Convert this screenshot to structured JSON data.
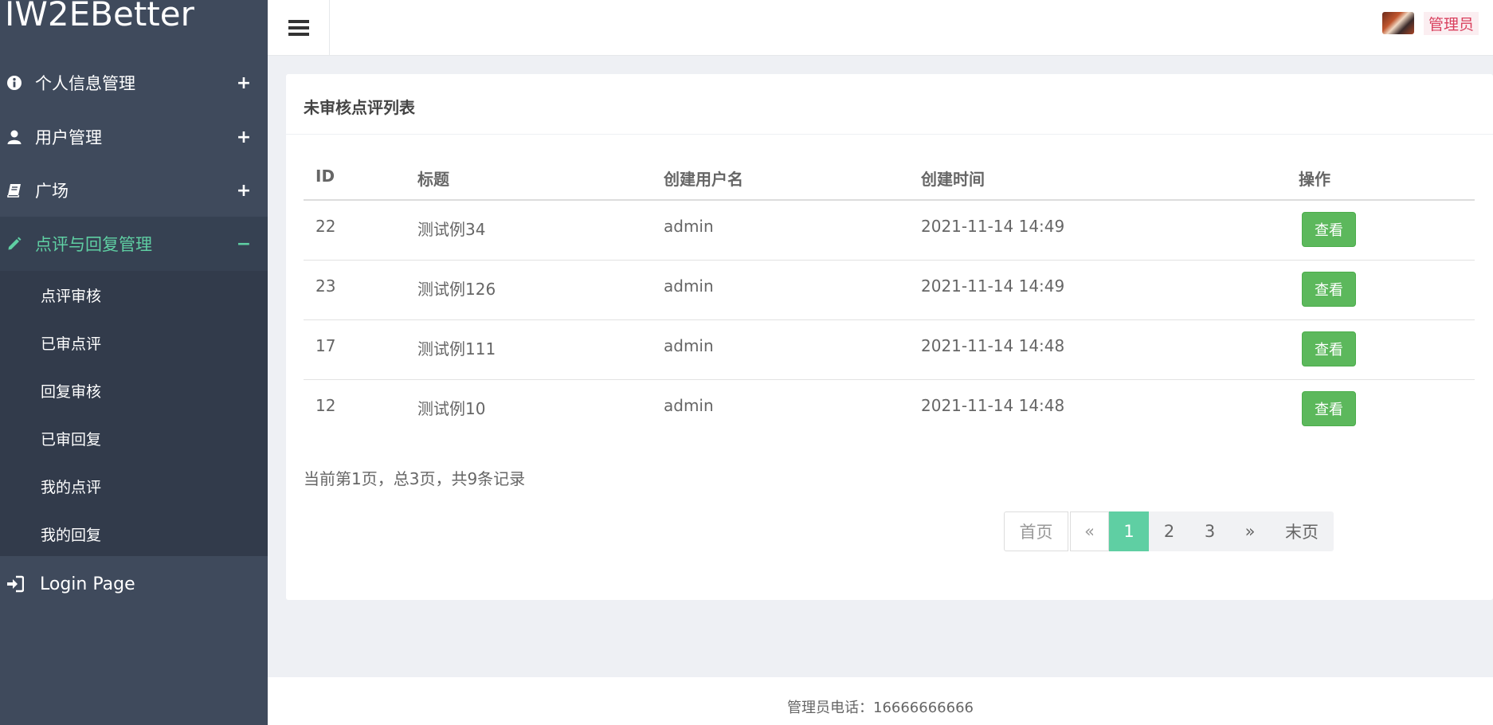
{
  "app": {
    "brand": "IW2EBetter"
  },
  "sidebar": {
    "items": [
      {
        "label": "个人信息管理",
        "toggle": "+"
      },
      {
        "label": "用户管理",
        "toggle": "+"
      },
      {
        "label": "广场",
        "toggle": "+"
      },
      {
        "label": "点评与回复管理",
        "toggle": "−"
      }
    ],
    "submenu": [
      "点评审核",
      "已审点评",
      "回复审核",
      "已审回复",
      "我的点评",
      "我的回复"
    ],
    "login": "Login Page",
    "active_color": "#5fcfa3"
  },
  "header": {
    "username": "管理员"
  },
  "main": {
    "title": "未审核点评列表",
    "columns": [
      "ID",
      "标题",
      "创建用户名",
      "创建时间",
      "操作"
    ],
    "rows": [
      {
        "id": "22",
        "title": "测试例34",
        "user": "admin",
        "time": "2021-11-14 14:49",
        "action": "查看"
      },
      {
        "id": "23",
        "title": "测试例126",
        "user": "admin",
        "time": "2021-11-14 14:49",
        "action": "查看"
      },
      {
        "id": "17",
        "title": "测试例111",
        "user": "admin",
        "time": "2021-11-14 14:48",
        "action": "查看"
      },
      {
        "id": "12",
        "title": "测试例10",
        "user": "admin",
        "time": "2021-11-14 14:48",
        "action": "查看"
      }
    ],
    "summary": "当前第1页，总3页，共9条记录",
    "pagination": {
      "first": "首页",
      "prev": "«",
      "pages": [
        "1",
        "2",
        "3"
      ],
      "next": "»",
      "last": "末页",
      "current": "1"
    }
  },
  "footer": {
    "text": "管理员电话：16666666666"
  }
}
